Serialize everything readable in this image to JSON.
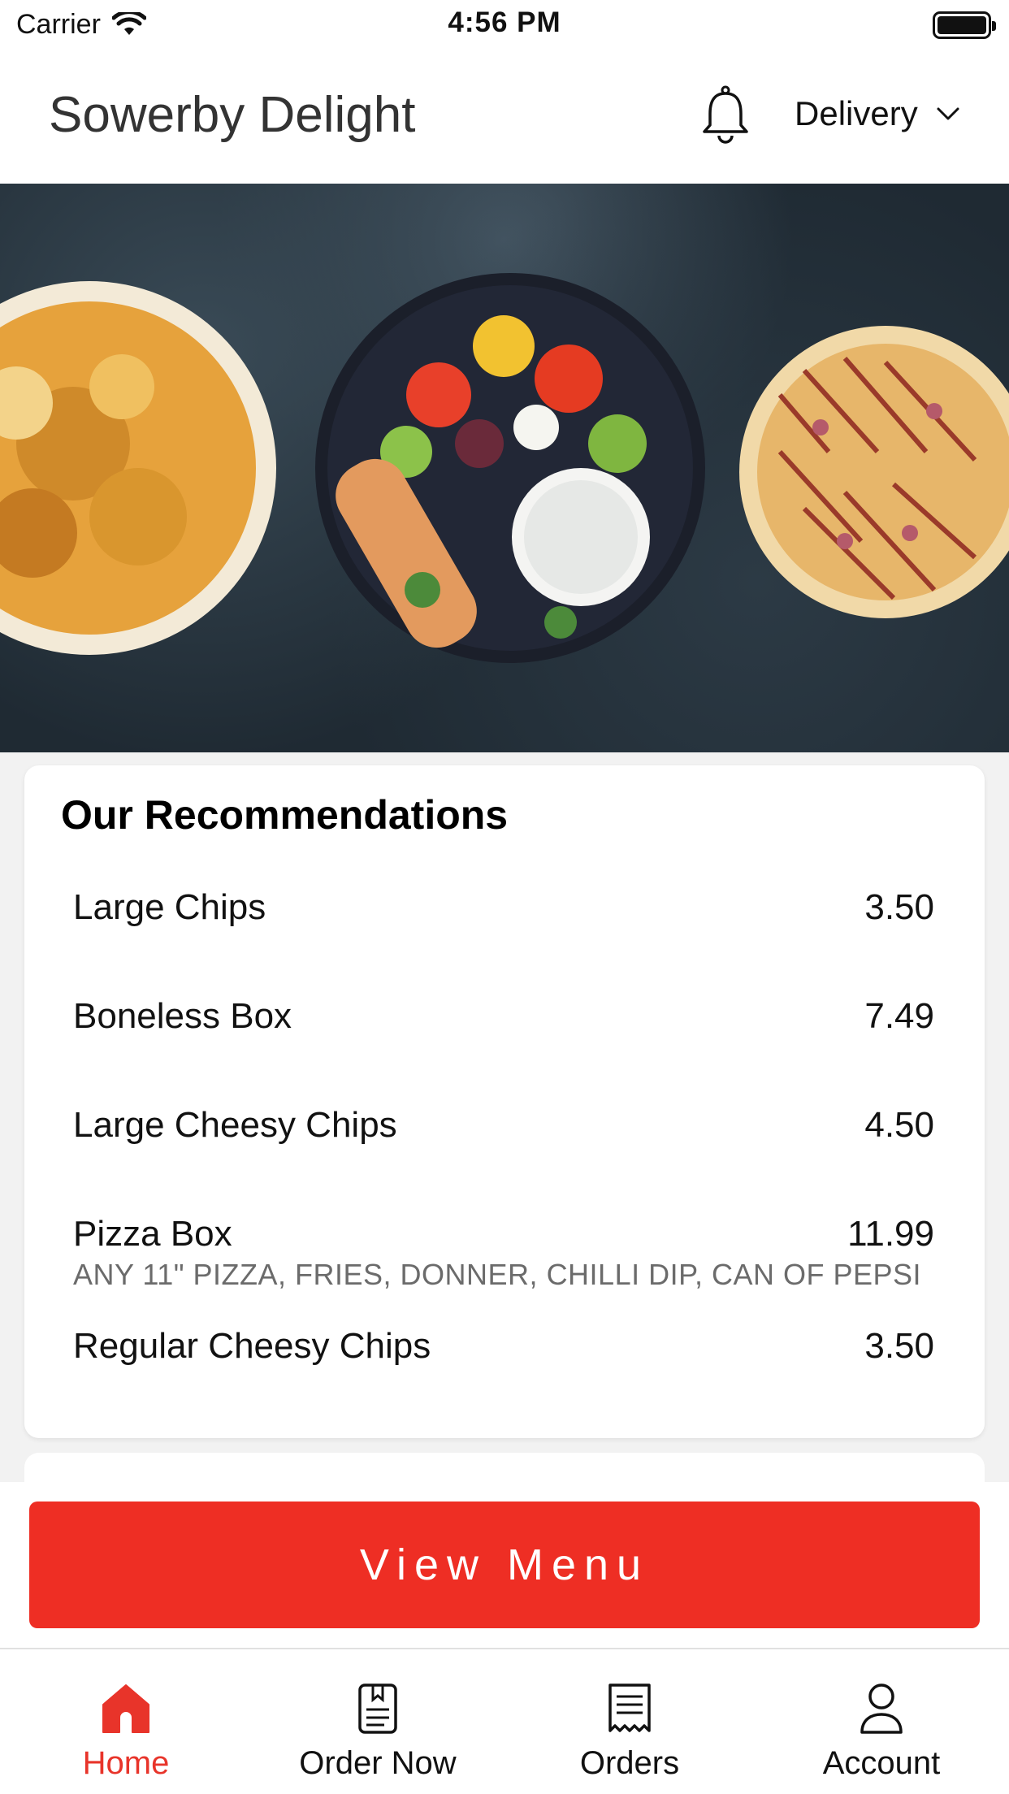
{
  "status_bar": {
    "carrier": "Carrier",
    "time": "4:56 PM"
  },
  "header": {
    "title": "Sowerby Delight",
    "delivery_label": "Delivery"
  },
  "recommendations": {
    "title": "Our Recommendations",
    "items": [
      {
        "name": "Large Chips",
        "price": "3.50",
        "description": ""
      },
      {
        "name": "Boneless Box",
        "price": "7.49",
        "description": ""
      },
      {
        "name": "Large Cheesy Chips",
        "price": "4.50",
        "description": ""
      },
      {
        "name": "Pizza Box",
        "price": "11.99",
        "description": "ANY 11\" PIZZA, FRIES, DONNER, CHILLI DIP, CAN OF PEPSI"
      },
      {
        "name": "Regular Cheesy Chips",
        "price": "3.50",
        "description": ""
      }
    ]
  },
  "cta": {
    "view_menu_label": "View Menu"
  },
  "tab_bar": {
    "tabs": [
      {
        "label": "Home",
        "icon": "home-icon",
        "active": true
      },
      {
        "label": "Order Now",
        "icon": "menu-book-icon",
        "active": false
      },
      {
        "label": "Orders",
        "icon": "receipt-icon",
        "active": false
      },
      {
        "label": "Account",
        "icon": "user-icon",
        "active": false
      }
    ]
  },
  "colors": {
    "accent": "#ee2e24",
    "active_tab": "#e8342a",
    "hero_background": "#1f2a33"
  }
}
